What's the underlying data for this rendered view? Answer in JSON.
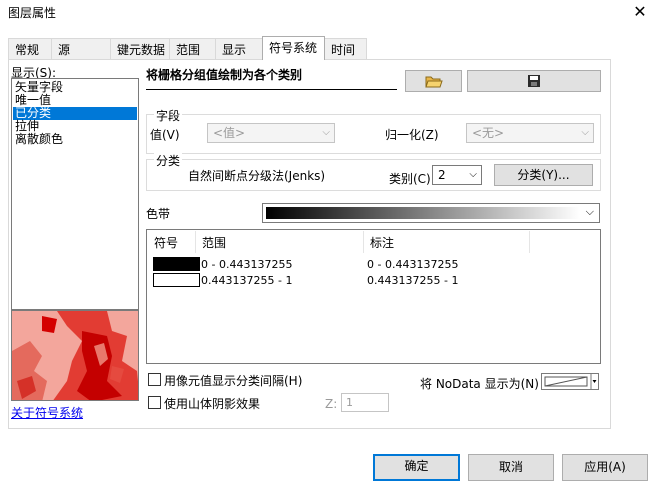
{
  "window": {
    "title": "图层属性",
    "close_label": "✕"
  },
  "tabs": [
    {
      "label": "常规"
    },
    {
      "label": "源"
    },
    {
      "label": "键元数据"
    },
    {
      "label": "范围"
    },
    {
      "label": "显示"
    },
    {
      "label": "符号系统",
      "active": true
    },
    {
      "label": "时间"
    }
  ],
  "show": {
    "label": "显示(S):",
    "items": [
      "矢量字段",
      "唯一值",
      "已分类",
      "拉伸",
      "离散颜色"
    ],
    "selected": "已分类"
  },
  "about_link": "关于符号系统",
  "heading": "将栅格分组值绘制为各个类别",
  "toolbar": {
    "open_icon": "folder-open-icon",
    "save_icon": "save-icon"
  },
  "fields": {
    "group_label": "字段",
    "value_label": "值(V)",
    "value_select": "<值>",
    "normalize_label": "归一化(Z)",
    "normalize_select": "<无>"
  },
  "classification": {
    "group_label": "分类",
    "method": "自然间断点分级法(Jenks)",
    "classes_label": "类别(C)",
    "classes_value": "2",
    "classify_button": "分类(Y)..."
  },
  "color_ramp": {
    "label": "色带"
  },
  "table": {
    "headers": {
      "symbol": "符号",
      "range": "范围",
      "label": "标注"
    },
    "rows": [
      {
        "color": "#000000",
        "range": "0 - 0.443137255",
        "label": "0 - 0.443137255"
      },
      {
        "color": "#ffffff",
        "range": "0.443137255 - 1",
        "label": "0.443137255 - 1"
      }
    ]
  },
  "options": {
    "show_class_breaks": "用像元值显示分类间隔(H)",
    "use_hillshade": "使用山体阴影效果",
    "z_label": "Z:",
    "z_value": "1",
    "nodata_label": "将 NoData 显示为(N)"
  },
  "buttons": {
    "ok": "确定",
    "cancel": "取消",
    "apply": "应用(A)"
  }
}
